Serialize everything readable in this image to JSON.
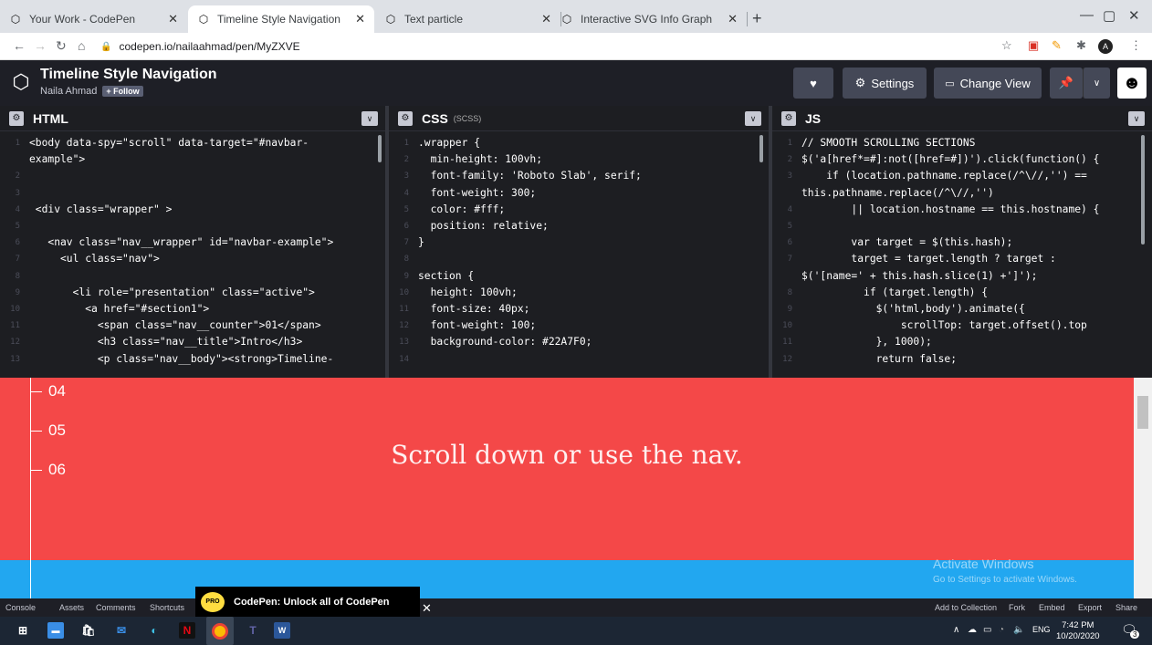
{
  "browser": {
    "tabs": [
      {
        "label": "Your Work - CodePen"
      },
      {
        "label": "Timeline Style Navigation"
      },
      {
        "label": "Text particle"
      },
      {
        "label": "Interactive SVG Info Graph"
      }
    ],
    "url": "codepen.io/nailaahmad/pen/MyZXVE"
  },
  "header": {
    "title": "Timeline Style Navigation",
    "author": "Naila Ahmad",
    "follow_label": "+ Follow",
    "settings_label": "Settings",
    "change_view_label": "Change View"
  },
  "panes": {
    "html": {
      "label": "HTML"
    },
    "css": {
      "label": "CSS",
      "sublabel": "(SCSS)"
    },
    "js": {
      "label": "JS"
    }
  },
  "html_code": [
    {
      "n": "1",
      "t": "<body data-spy=\"scroll\" data-target=\"#navbar-"
    },
    {
      "n": "",
      "t": "example\">"
    },
    {
      "n": "2",
      "t": ""
    },
    {
      "n": "3",
      "t": ""
    },
    {
      "n": "4",
      "t": " <div class=\"wrapper\" >"
    },
    {
      "n": "5",
      "t": ""
    },
    {
      "n": "6",
      "t": "   <nav class=\"nav__wrapper\" id=\"navbar-example\">"
    },
    {
      "n": "7",
      "t": "     <ul class=\"nav\">"
    },
    {
      "n": "8",
      "t": ""
    },
    {
      "n": "9",
      "t": "       <li role=\"presentation\" class=\"active\">"
    },
    {
      "n": "10",
      "t": "         <a href=\"#section1\">"
    },
    {
      "n": "11",
      "t": "           <span class=\"nav__counter\">01</span>"
    },
    {
      "n": "12",
      "t": "           <h3 class=\"nav__title\">Intro</h3>"
    },
    {
      "n": "13",
      "t": "           <p class=\"nav__body\"><strong>Timeline-"
    }
  ],
  "css_code": [
    {
      "n": "1",
      "t": ".wrapper {"
    },
    {
      "n": "2",
      "t": "  min-height: 100vh;"
    },
    {
      "n": "3",
      "t": "  font-family: 'Roboto Slab', serif;"
    },
    {
      "n": "4",
      "t": "  font-weight: 300;"
    },
    {
      "n": "5",
      "t": "  color: #fff;"
    },
    {
      "n": "6",
      "t": "  position: relative;"
    },
    {
      "n": "7",
      "t": "}"
    },
    {
      "n": "8",
      "t": ""
    },
    {
      "n": "9",
      "t": "section {"
    },
    {
      "n": "10",
      "t": "  height: 100vh;"
    },
    {
      "n": "11",
      "t": "  font-size: 40px;"
    },
    {
      "n": "12",
      "t": "  font-weight: 100;"
    },
    {
      "n": "13",
      "t": "  background-color: #22A7F0;"
    },
    {
      "n": "14",
      "t": ""
    }
  ],
  "js_code": [
    {
      "n": "1",
      "t": "// SMOOTH SCROLLING SECTIONS"
    },
    {
      "n": "2",
      "t": "$('a[href*=#]:not([href=#])').click(function() {"
    },
    {
      "n": "3",
      "t": "    if (location.pathname.replace(/^\\//,'') =="
    },
    {
      "n": "",
      "t": "this.pathname.replace(/^\\//,'')"
    },
    {
      "n": "4",
      "t": "        || location.hostname == this.hostname) {"
    },
    {
      "n": "5",
      "t": ""
    },
    {
      "n": "6",
      "t": "        var target = $(this.hash);"
    },
    {
      "n": "7",
      "t": "        target = target.length ? target :"
    },
    {
      "n": "",
      "t": "$('[name=' + this.hash.slice(1) +']');"
    },
    {
      "n": "8",
      "t": "          if (target.length) {"
    },
    {
      "n": "9",
      "t": "            $('html,body').animate({"
    },
    {
      "n": "10",
      "t": "                scrollTop: target.offset().top"
    },
    {
      "n": "11",
      "t": "            }, 1000);"
    },
    {
      "n": "12",
      "t": "            return false;"
    }
  ],
  "preview": {
    "items": [
      "04",
      "05",
      "06"
    ],
    "message": "Scroll down or use the nav.",
    "watermark_title": "Activate Windows",
    "watermark_sub": "Go to Settings to activate Windows."
  },
  "bottom": {
    "left": [
      "Console",
      "Assets",
      "Comments",
      "Shortcuts"
    ],
    "promo": "CodePen: Unlock all of CodePen",
    "promo_badge": "PRO",
    "right": [
      "Add to Collection",
      "Fork",
      "Embed",
      "Export",
      "Share"
    ]
  },
  "taskbar": {
    "time": "7:42 PM",
    "date": "10/20/2020",
    "lang": "ENG",
    "notif_count": "3"
  },
  "colors": {
    "preview_red": "#f44848",
    "preview_blue": "#22a7f0",
    "editor_bg": "#1d1e22"
  }
}
